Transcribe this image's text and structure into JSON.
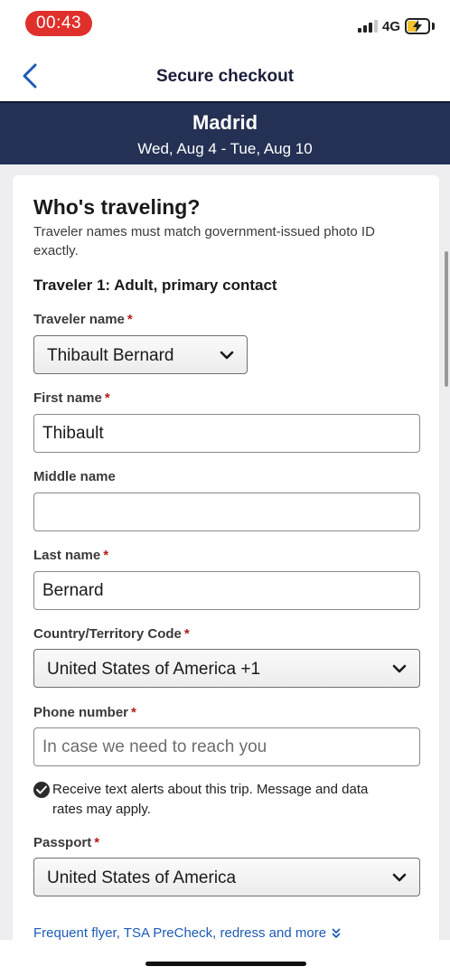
{
  "status_bar": {
    "time": "00:43",
    "network": "4G",
    "battery_level": 0.35
  },
  "nav": {
    "title": "Secure checkout",
    "back_icon": "chevron-left-icon"
  },
  "banner": {
    "city": "Madrid",
    "dates": "Wed, Aug 4 - Tue, Aug 10"
  },
  "form": {
    "title": "Who's traveling?",
    "subtitle": "Traveler names must match government-issued photo ID exactly.",
    "traveler_heading": "Traveler 1: Adult, primary contact",
    "required_mark": "*",
    "traveler_name": {
      "label": "Traveler name",
      "value": "Thibault Bernard"
    },
    "first_name": {
      "label": "First name",
      "value": "Thibault"
    },
    "middle_name": {
      "label": "Middle name",
      "value": ""
    },
    "last_name": {
      "label": "Last name",
      "value": "Bernard"
    },
    "country_code": {
      "label": "Country/Territory Code",
      "value": "United States of America +1"
    },
    "phone": {
      "label": "Phone number",
      "value": "",
      "placeholder": "In case we need to reach you"
    },
    "text_alerts": {
      "label": "Receive text alerts about this trip. Message and data rates may apply.",
      "checked": true
    },
    "passport": {
      "label": "Passport",
      "value": "United States of America"
    },
    "more_link": "Frequent flyer, TSA PreCheck, redress and more"
  },
  "colors": {
    "accent": "#1d5bb5",
    "banner": "#243154",
    "required": "#b31b1b",
    "time_pill": "#e0302b"
  }
}
